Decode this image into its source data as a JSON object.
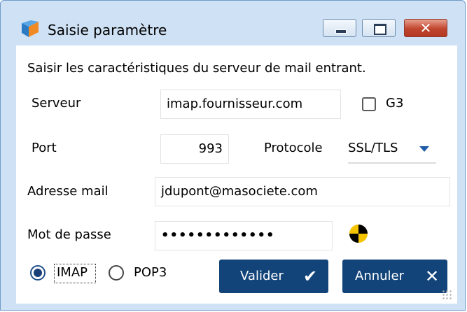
{
  "window": {
    "title": "Saisie paramètre",
    "icon": "app-logo-icon",
    "controls": [
      "minimize-icon",
      "maximize-icon",
      "close-icon"
    ]
  },
  "form": {
    "instruction": "Saisir les caractéristiques du serveur de mail entrant.",
    "server": {
      "label": "Serveur",
      "value": "imap.fournisseur.com"
    },
    "g3": {
      "label": "G3",
      "checked": false
    },
    "port": {
      "label": "Port",
      "value": "993"
    },
    "protocol": {
      "label": "Protocole",
      "value": "SSL/TLS"
    },
    "email": {
      "label": "Adresse mail",
      "value": "jdupont@masociete.com"
    },
    "password": {
      "label": "Mot de passe",
      "value": "•••••••••••••",
      "reveal_icon": "show-password-icon"
    },
    "mode": {
      "options": [
        {
          "label": "IMAP",
          "selected": true
        },
        {
          "label": "POP3",
          "selected": false
        }
      ]
    }
  },
  "actions": {
    "validate": {
      "label": "Valider",
      "icon": "check-icon"
    },
    "cancel": {
      "label": "Annuler",
      "icon": "x-icon"
    }
  },
  "colors": {
    "button_bg": "#12447a",
    "title_bg": "#cfe1f4",
    "accent": "#1f5da8"
  }
}
